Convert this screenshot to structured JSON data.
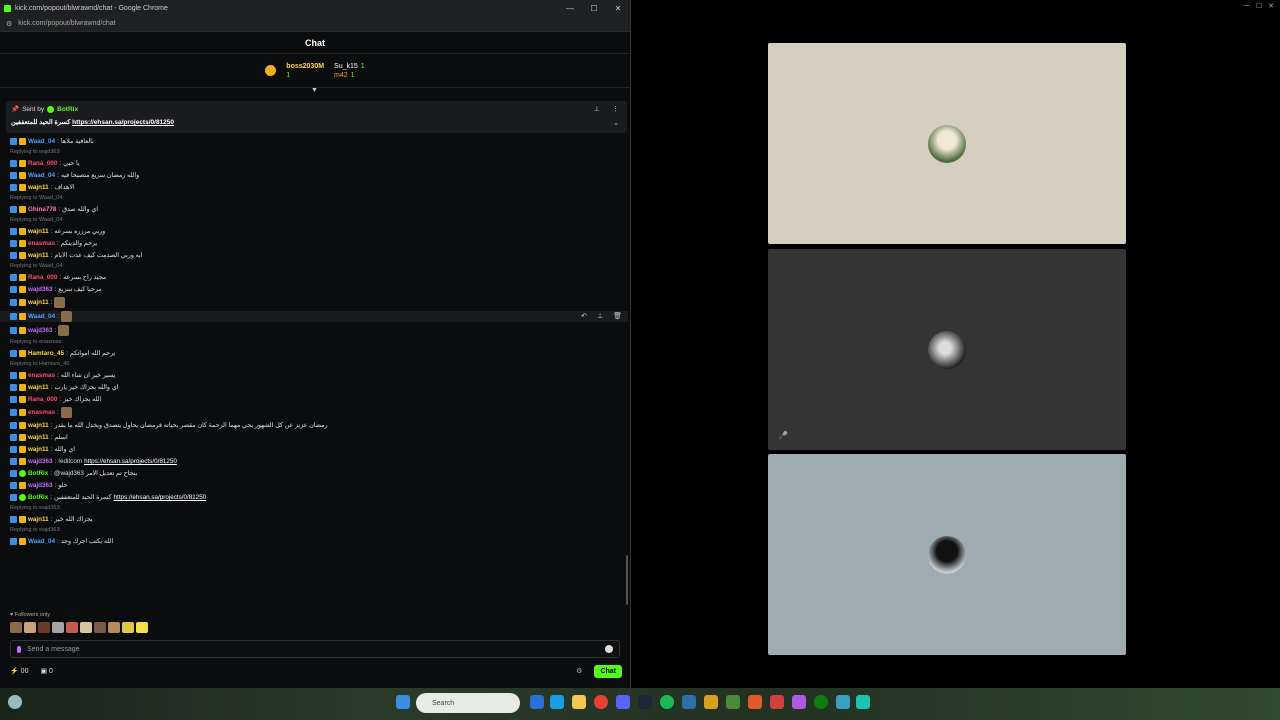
{
  "window": {
    "title": "kick.com/popout/blwrawnd/chat - Google Chrome",
    "url": "kick.com/popout/blwrawnd/chat",
    "min": "—",
    "max": "☐",
    "close": "✕"
  },
  "chat": {
    "header": "Chat"
  },
  "leaderboard": {
    "first": {
      "name": "boss2030M",
      "count": "1"
    },
    "second": {
      "name": "Su_k15",
      "count": "1"
    },
    "third": {
      "name": "m42",
      "count": "1"
    }
  },
  "pinned": {
    "sent_by": "Sent by",
    "bot": "BotRix",
    "text": "كسرة الحيد للمتعففين",
    "link": "https://ehsan.sa/projects/0/81250"
  },
  "messages": [
    {
      "reply": "",
      "user": "Waad_04",
      "color": "c-blue",
      "text": "بالعافية ملاها"
    },
    {
      "reply": "Replying to wajd363:",
      "user": "",
      "color": "",
      "text": ""
    },
    {
      "reply": "",
      "user": "Rana_000",
      "color": "c-red",
      "text": "يا حبي"
    },
    {
      "reply": "",
      "user": "Waad_04",
      "color": "c-blue",
      "text": "والله رمضان سريع متصبحا فيه"
    },
    {
      "reply": "",
      "user": "wajn11",
      "color": "c-yellow",
      "text": "الاهداف"
    },
    {
      "reply": "Replying to Waad_04:",
      "user": "Ghina778",
      "color": "c-pink",
      "text": "اي والله صدق"
    },
    {
      "reply": "Replying to Waad_04:",
      "user": "wajn11",
      "color": "c-yellow",
      "text": "وربي مرزره بسرعه"
    },
    {
      "reply": "",
      "user": "enasmas",
      "color": "c-red",
      "text": "يرحم والدينكم"
    },
    {
      "reply": "",
      "user": "wajn11",
      "color": "c-yellow",
      "text": "ايه وربي الصدمت كيف عدت الايام"
    },
    {
      "reply": "Replying to Waad_04:",
      "user": "Rana_000",
      "color": "c-red",
      "text": "مجيد راح بسرعه"
    },
    {
      "reply": "",
      "user": "wajd363",
      "color": "c-purple",
      "text": "مرحبا كيف سريع"
    },
    {
      "reply": "",
      "user": "wajn11",
      "color": "c-yellow",
      "text": ""
    },
    {
      "reply": "",
      "user": "Waad_04",
      "color": "c-blue",
      "text": ""
    },
    {
      "reply": "",
      "user": "wajd363",
      "color": "c-purple",
      "text": ""
    },
    {
      "reply": "Replying to enasmas:",
      "user": "Hamtaro_45",
      "color": "c-yellow",
      "text": "يرحم الله امواتكم"
    },
    {
      "reply": "Replying to Hamtaro_45:",
      "user": "enasmas",
      "color": "c-red",
      "text": "يسير خير ان شاء الله"
    },
    {
      "reply": "",
      "user": "wajn11",
      "color": "c-yellow",
      "text": "اي والله يجزاك خير يارب"
    },
    {
      "reply": "",
      "user": "Rana_000",
      "color": "c-red",
      "text": "الله يجزاك خير"
    },
    {
      "reply": "",
      "user": "enasmas",
      "color": "c-red",
      "text": ""
    },
    {
      "reply": "",
      "user": "wajn11",
      "color": "c-yellow",
      "text": "رمضان عزيز عن كل الشهور يجي مهما الزحمة كان مقصر بحياته فرمضان يحاول يتصدق ويخدل الله ما يقدر"
    },
    {
      "reply": "",
      "user": "wajn11",
      "color": "c-yellow",
      "text": "اسلم"
    },
    {
      "reply": "",
      "user": "wajn11",
      "color": "c-yellow",
      "text": "اي والله"
    },
    {
      "reply": "",
      "user": "wajd363",
      "color": "c-purple",
      "text": "!editcom",
      "link": "https://ehsan.sa/projects/0/81250"
    },
    {
      "reply": "",
      "user": "BotRix",
      "color": "c-green",
      "text": "@wajd363 بنجاح تم تعديل الامر"
    },
    {
      "reply": "",
      "user": "wajd363",
      "color": "c-purple",
      "text": "حلو"
    },
    {
      "reply": "",
      "user": "BotRix",
      "color": "c-green",
      "text": "كسرة الحيد للمتعففين",
      "link": "https://ehsan.sa/projects/0/81250"
    },
    {
      "reply": "Replying to wajd363:",
      "user": "wajn11",
      "color": "c-yellow",
      "text": "يجزاك الله خير"
    },
    {
      "reply": "Replying to wajd363:",
      "user": "Waad_04",
      "color": "c-blue",
      "text": "الله يكتب اجرك وجد"
    }
  ],
  "followers": "Followers only",
  "input": {
    "placeholder": "Send a message"
  },
  "footer": {
    "points": "00",
    "count": "0",
    "chat_button": "Chat"
  },
  "taskbar": {
    "search_placeholder": "Search"
  },
  "colors": {
    "accent": "#53fc18",
    "tile1": "#d6cfc1",
    "tile2": "#343434",
    "tile3": "#9eabb3"
  }
}
